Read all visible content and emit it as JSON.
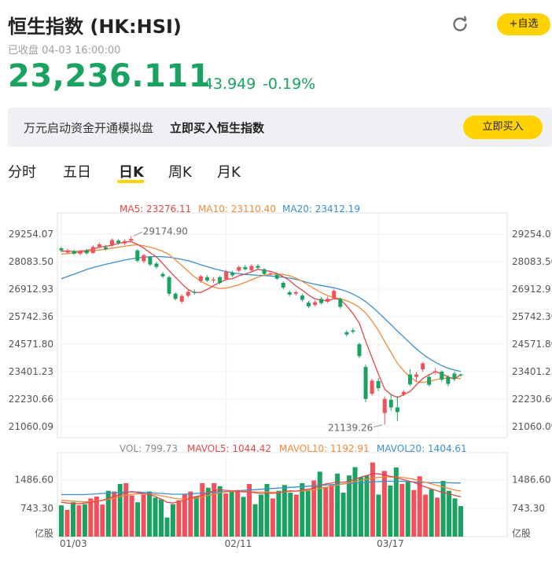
{
  "header": {
    "title": "恒生指数 (HK:HSI)",
    "status": "已收盘 04-03 16:00:00",
    "price": "23,236.111",
    "change": "-43.949",
    "change_pct": "-0.19%",
    "add_watchlist_label": "+自选",
    "refresh_icon": "refresh-icon"
  },
  "banner": {
    "text": "万元启动资金开通模拟盘",
    "highlight": "立即买入恒生指数",
    "button_label": "立即买入"
  },
  "tabs": [
    {
      "label": "分时",
      "active": false
    },
    {
      "label": "五日",
      "active": false
    },
    {
      "label": "日K",
      "active": true
    },
    {
      "label": "周K",
      "active": false
    },
    {
      "label": "月K",
      "active": false
    }
  ],
  "colors": {
    "up": "#f0515a",
    "down": "#1aa260",
    "ma5": "#e0474c",
    "ma10": "#f08a3a",
    "ma20": "#3a8fd0",
    "accent": "#ffd200"
  },
  "chart_data": [
    {
      "type": "candlestick",
      "legend": [
        {
          "label": "MA5: 23276.11",
          "color": "#e0474c"
        },
        {
          "label": "MA10: 23110.40",
          "color": "#f08a3a"
        },
        {
          "label": "MA20: 23412.19",
          "color": "#3a8fd0"
        }
      ],
      "y_ticks": [
        "29254.07",
        "28083.50",
        "26912.93",
        "25742.36",
        "24571.80",
        "23401.23",
        "22230.66",
        "21060.09"
      ],
      "ylim": [
        21060.09,
        29254.07
      ],
      "x_ticks": [
        {
          "label": "01/03",
          "index": 0
        },
        {
          "label": "02/11",
          "index": 26
        },
        {
          "label": "03/17",
          "index": 50
        }
      ],
      "annotations": [
        {
          "label": "29174.90",
          "index": 11,
          "value": 29174.9
        },
        {
          "label": "21139.26",
          "index": 51,
          "value": 21139.26
        }
      ],
      "candles": [
        [
          28650,
          28560,
          28720,
          28480
        ],
        [
          28470,
          28560,
          28640,
          28400
        ],
        [
          28540,
          28420,
          28610,
          28360
        ],
        [
          28420,
          28510,
          28580,
          28350
        ],
        [
          28560,
          28440,
          28640,
          28380
        ],
        [
          28450,
          28710,
          28780,
          28420
        ],
        [
          28720,
          28820,
          28900,
          28660
        ],
        [
          28700,
          28620,
          28800,
          28560
        ],
        [
          28760,
          29000,
          29080,
          28720
        ],
        [
          28980,
          28880,
          29050,
          28800
        ],
        [
          28860,
          28960,
          29020,
          28780
        ],
        [
          28980,
          29050,
          29174.9,
          28900
        ],
        [
          28560,
          28120,
          28620,
          28050
        ],
        [
          28100,
          28360,
          28420,
          28020
        ],
        [
          28280,
          27960,
          28320,
          27880
        ],
        [
          28000,
          27860,
          28080,
          27780
        ],
        [
          27560,
          27460,
          27640,
          27380
        ],
        [
          27420,
          26720,
          27480,
          26620
        ],
        [
          26720,
          26500,
          26780,
          26440
        ],
        [
          26380,
          26620,
          26700,
          26300
        ],
        [
          26630,
          26800,
          26880,
          26560
        ],
        [
          26800,
          26760,
          26900,
          26680
        ],
        [
          27260,
          27460,
          27520,
          27180
        ],
        [
          27420,
          27280,
          27500,
          27220
        ],
        [
          27280,
          27320,
          27420,
          27180
        ],
        [
          27420,
          27180,
          27480,
          27120
        ],
        [
          27340,
          27660,
          27740,
          27280
        ],
        [
          27600,
          27500,
          27700,
          27420
        ],
        [
          27700,
          27850,
          27920,
          27620
        ],
        [
          27850,
          27760,
          27950,
          27700
        ],
        [
          27720,
          27900,
          27980,
          27660
        ],
        [
          27900,
          27820,
          27980,
          27740
        ],
        [
          27760,
          27560,
          27820,
          27480
        ],
        [
          27560,
          27580,
          27680,
          27500
        ],
        [
          27520,
          27360,
          27600,
          27300
        ],
        [
          27180,
          26980,
          27240,
          26900
        ],
        [
          26780,
          26680,
          26860,
          26600
        ],
        [
          26720,
          26780,
          26860,
          26640
        ],
        [
          26640,
          26460,
          26720,
          26380
        ],
        [
          26340,
          26180,
          26420,
          26100
        ],
        [
          26240,
          26360,
          26440,
          26180
        ],
        [
          26500,
          26320,
          26580,
          26260
        ],
        [
          26380,
          26500,
          26600,
          26320
        ],
        [
          26520,
          26840,
          26920,
          26480
        ],
        [
          26500,
          26160,
          26560,
          26080
        ],
        [
          25080,
          24980,
          25160,
          24900
        ],
        [
          25160,
          25100,
          25260,
          25020
        ],
        [
          24570,
          24060,
          24640,
          23980
        ],
        [
          23600,
          22240,
          23700,
          22100
        ],
        [
          22460,
          23020,
          23100,
          22380
        ],
        [
          23000,
          22700,
          23120,
          22580
        ],
        [
          21640,
          22240,
          22340,
          21139.26
        ],
        [
          22200,
          21880,
          22460,
          21740
        ],
        [
          21880,
          21680,
          22360,
          21300
        ],
        [
          22430,
          22540,
          22620,
          22360
        ],
        [
          23280,
          22860,
          23500,
          22800
        ],
        [
          23180,
          23280,
          23380,
          22980
        ],
        [
          23500,
          23750,
          23820,
          23400
        ],
        [
          23180,
          22840,
          23250,
          22780
        ],
        [
          23380,
          23420,
          23560,
          23280
        ],
        [
          23400,
          23060,
          23460,
          22980
        ],
        [
          23180,
          22880,
          23260,
          22780
        ],
        [
          23320,
          23100,
          23400,
          23000
        ],
        [
          23280,
          23236.11,
          23320,
          23180
        ]
      ],
      "ma5": [
        28520,
        28540,
        28510,
        28530,
        28560,
        28620,
        28700,
        28740,
        28780,
        28860,
        28920,
        28940,
        28820,
        28660,
        28460,
        28280,
        28000,
        27700,
        27420,
        27140,
        26900,
        26760,
        26780,
        26900,
        27060,
        27200,
        27320,
        27360,
        27480,
        27560,
        27650,
        27760,
        27710,
        27670,
        27580,
        27440,
        27280,
        27050,
        26870,
        26660,
        26500,
        26440,
        26420,
        26500,
        26480,
        26200,
        25880,
        25460,
        24700,
        24000,
        23300,
        22660,
        22420,
        22300,
        22420,
        22560,
        22840,
        23110,
        23270,
        23400,
        23300,
        23180,
        23080,
        23276.11
      ],
      "ma10": [
        28400,
        28420,
        28450,
        28480,
        28510,
        28550,
        28580,
        28610,
        28660,
        28700,
        28740,
        28780,
        28800,
        28760,
        28700,
        28620,
        28520,
        28380,
        28160,
        27920,
        27670,
        27440,
        27250,
        27100,
        27000,
        26940,
        26960,
        27020,
        27100,
        27200,
        27310,
        27420,
        27500,
        27550,
        27560,
        27540,
        27480,
        27380,
        27240,
        27080,
        26920,
        26760,
        26640,
        26560,
        26500,
        26420,
        26300,
        26140,
        25900,
        25560,
        25160,
        24680,
        24220,
        23760,
        23440,
        23160,
        22980,
        22940,
        22980,
        23060,
        23100,
        23140,
        23120,
        23110.4
      ],
      "ma20": [
        27350,
        27450,
        27550,
        27650,
        27750,
        27830,
        27900,
        27970,
        28030,
        28090,
        28150,
        28200,
        28240,
        28270,
        28290,
        28300,
        28290,
        28270,
        28230,
        28180,
        28120,
        28040,
        27950,
        27870,
        27790,
        27720,
        27660,
        27610,
        27570,
        27540,
        27520,
        27500,
        27490,
        27470,
        27450,
        27420,
        27380,
        27330,
        27260,
        27180,
        27120,
        27070,
        27020,
        26970,
        26900,
        26820,
        26700,
        26560,
        26380,
        26160,
        25920,
        25660,
        25400,
        25130,
        24880,
        24620,
        24370,
        24150,
        23960,
        23800,
        23660,
        23550,
        23470,
        23412.19
      ]
    },
    {
      "type": "bar",
      "legend": [
        {
          "label": "VOL: 799.73",
          "color": "#888888"
        },
        {
          "label": "MAVOL5: 1044.42",
          "color": "#e0474c"
        },
        {
          "label": "MAVOL10: 1192.91",
          "color": "#f08a3a"
        },
        {
          "label": "MAVOL20: 1404.61",
          "color": "#3a8fd0"
        }
      ],
      "y_ticks": [
        "1486.60",
        "743.30"
      ],
      "unit": "亿股",
      "ylim": [
        0,
        2200
      ],
      "volumes": [
        820,
        700,
        900,
        820,
        850,
        1000,
        1050,
        840,
        1200,
        1180,
        1380,
        1400,
        1080,
        900,
        1100,
        1180,
        1020,
        980,
        500,
        850,
        950,
        1120,
        1180,
        1060,
        1400,
        1280,
        1400,
        1320,
        1130,
        1180,
        1220,
        1040,
        1380,
        850,
        1100,
        1380,
        1000,
        1200,
        1350,
        1150,
        1100,
        1400,
        1200,
        1470,
        1700,
        1300,
        1350,
        1650,
        1150,
        1600,
        1820,
        1560,
        1600,
        1940,
        1100,
        1720,
        1340,
        1810,
        1380,
        1450,
        1220,
        1580,
        1100,
        1240,
        1020,
        1460,
        1200,
        1000,
        799.73
      ],
      "mavol5": [
        900,
        880,
        870,
        860,
        880,
        900,
        920,
        950,
        1000,
        1050,
        1100,
        1150,
        1180,
        1150,
        1130,
        1100,
        1050,
        980,
        900,
        880,
        920,
        960,
        1000,
        1050,
        1080,
        1150,
        1200,
        1230,
        1210,
        1200,
        1190,
        1170,
        1170,
        1150,
        1130,
        1140,
        1130,
        1150,
        1180,
        1200,
        1190,
        1220,
        1240,
        1270,
        1330,
        1380,
        1400,
        1430,
        1420,
        1450,
        1500,
        1560,
        1600,
        1650,
        1640,
        1620,
        1580,
        1550,
        1500,
        1460,
        1420,
        1360,
        1300,
        1250,
        1200,
        1150,
        1120,
        1080,
        1044.42
      ],
      "mavol10": [
        950,
        940,
        930,
        920,
        910,
        920,
        930,
        950,
        980,
        1010,
        1050,
        1080,
        1110,
        1120,
        1120,
        1110,
        1100,
        1070,
        1040,
        1010,
        990,
        980,
        990,
        1010,
        1040,
        1080,
        1110,
        1150,
        1170,
        1180,
        1190,
        1190,
        1180,
        1170,
        1170,
        1170,
        1160,
        1160,
        1170,
        1180,
        1190,
        1200,
        1210,
        1230,
        1260,
        1290,
        1320,
        1350,
        1380,
        1410,
        1440,
        1470,
        1500,
        1530,
        1550,
        1560,
        1560,
        1560,
        1550,
        1530,
        1500,
        1460,
        1420,
        1380,
        1340,
        1300,
        1260,
        1220,
        1192.91
      ],
      "mavol20": [
        1100,
        1100,
        1100,
        1100,
        1100,
        1110,
        1120,
        1130,
        1140,
        1150,
        1160,
        1170,
        1170,
        1170,
        1160,
        1150,
        1140,
        1130,
        1120,
        1110,
        1110,
        1110,
        1120,
        1130,
        1140,
        1150,
        1160,
        1170,
        1180,
        1190,
        1200,
        1210,
        1220,
        1230,
        1240,
        1250,
        1260,
        1270,
        1280,
        1290,
        1300,
        1310,
        1320,
        1330,
        1340,
        1350,
        1360,
        1370,
        1380,
        1390,
        1400,
        1410,
        1420,
        1430,
        1440,
        1450,
        1450,
        1450,
        1450,
        1440,
        1430,
        1420,
        1420,
        1410,
        1410,
        1410,
        1410,
        1405,
        1404.61
      ]
    }
  ]
}
